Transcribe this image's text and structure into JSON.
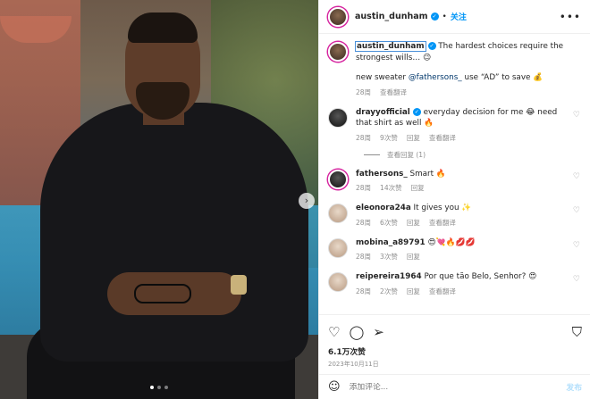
{
  "post": {
    "username": "austin_dunham",
    "follow_separator": "•",
    "follow_label": "关注",
    "more_icon": "more-horizontal-icon"
  },
  "carousel": {
    "next_arrow": "›",
    "dot_count": 3,
    "active_dot": 1
  },
  "caption": {
    "username": "austin_dunham",
    "text": " The hardest choices require the strongest wills… 😉",
    "line2_prefix": "new sweater ",
    "line2_mention": "@fathersons_",
    "line2_suffix": " use “AD” to save 💰",
    "time": "28周",
    "translate": "查看翻译"
  },
  "comments": [
    {
      "username": "drayyofficial",
      "verified": true,
      "text": " everyday decision for me 😂 need that shirt as well 🔥",
      "time": "28周",
      "likes": "9次赞",
      "reply": "回复",
      "translate": "查看翻译",
      "view_replies": "查看回复 (1)"
    },
    {
      "username": "fathersons_",
      "verified": false,
      "text": " Smart 🔥",
      "time": "28周",
      "likes": "14次赞",
      "reply": "回复"
    },
    {
      "username": "eleonora24a",
      "verified": false,
      "text": " It gives you ✨",
      "time": "28周",
      "likes": "6次赞",
      "reply": "回复",
      "translate": "查看翻译"
    },
    {
      "username": "mobina_a89791",
      "verified": false,
      "text": " 😍💘🔥💋💋",
      "time": "28周",
      "likes": "3次赞",
      "reply": "回复"
    },
    {
      "username": "reipereira1964",
      "verified": false,
      "text": " Por que tão Belo, Senhor? 😍",
      "time": "28周",
      "likes": "2次赞",
      "reply": "回复",
      "translate": "查看翻译"
    }
  ],
  "actions": {
    "like_icon": "heart-icon",
    "comment_icon": "comment-icon",
    "share_icon": "send-icon",
    "save_icon": "bookmark-icon",
    "likes_count": "6.1万次赞",
    "date": "2023年10月11日"
  },
  "add_comment": {
    "placeholder": "添加评论...",
    "post_label": "发布"
  },
  "colors": {
    "accent": "#0095f6",
    "text": "#262626",
    "muted": "#8e8e8e"
  }
}
